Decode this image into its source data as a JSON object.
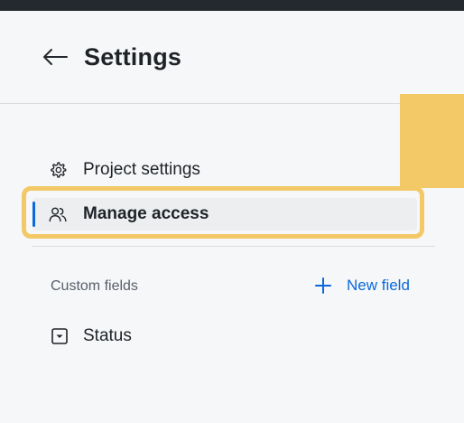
{
  "header": {
    "back_icon": "arrow-left-icon",
    "title": "Settings"
  },
  "nav": {
    "items": [
      {
        "label": "Project settings",
        "icon": "gear-icon",
        "selected": false
      },
      {
        "label": "Manage access",
        "icon": "people-icon",
        "selected": true
      }
    ]
  },
  "custom_fields": {
    "section_label": "Custom fields",
    "new_field_label": "New field",
    "new_field_icon": "plus-icon",
    "fields": [
      {
        "label": "Status",
        "icon": "single-select-icon"
      }
    ]
  },
  "colors": {
    "accent": "#0969da",
    "highlight": "#f3c866",
    "topbar": "#24292f"
  }
}
